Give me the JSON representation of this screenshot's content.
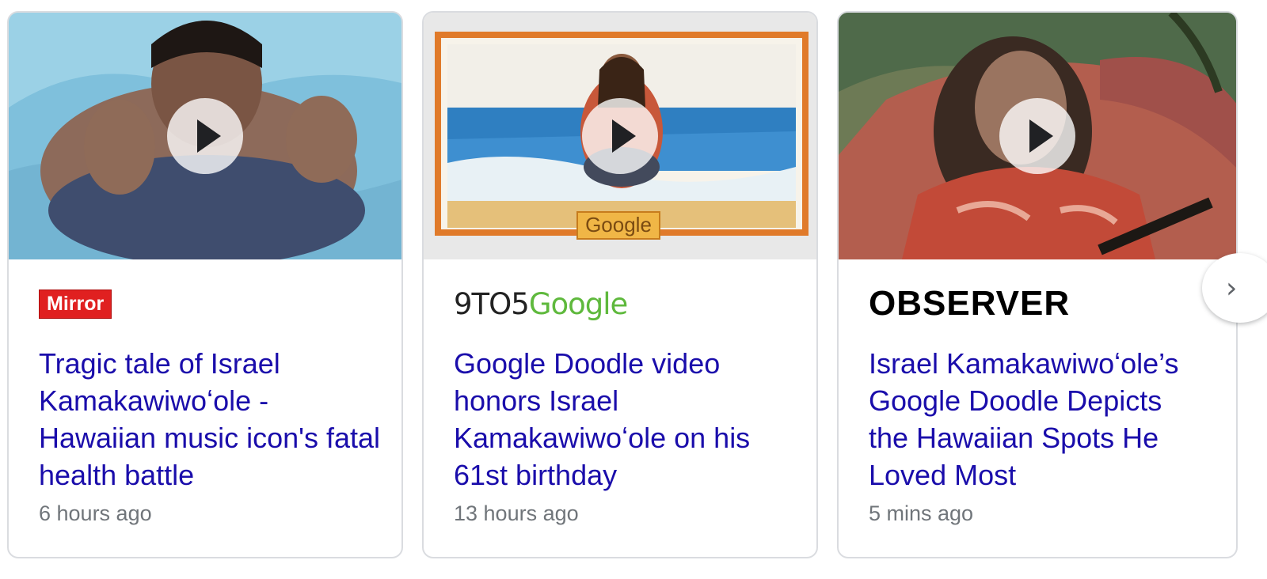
{
  "cards": [
    {
      "source": "Mirror",
      "title": "Tragic tale of Israel Kamakawiwoʻole - Hawaiian music icon's fatal health battle",
      "time": "6 hours ago",
      "brand_color": "#e02020"
    },
    {
      "source_prefix": "9TO5",
      "source_suffix": "Google",
      "title": "Google Doodle video honors Israel Kamakawiwoʻole on his 61st birthday",
      "time": "13 hours ago",
      "thumbnail_sign": "Google",
      "brand_color": "#5fb93d"
    },
    {
      "source": "OBSERVER",
      "title": "Israel Kamakawiwoʻole’s Google Doodle Depicts the Hawaiian Spots He Loved Most",
      "time": "5 mins ago",
      "brand_color": "#000000"
    }
  ],
  "next_button": {
    "icon": "chevron-right-icon",
    "glyph": "›"
  },
  "link_color": "#1a0dab",
  "meta_color": "#70757a"
}
